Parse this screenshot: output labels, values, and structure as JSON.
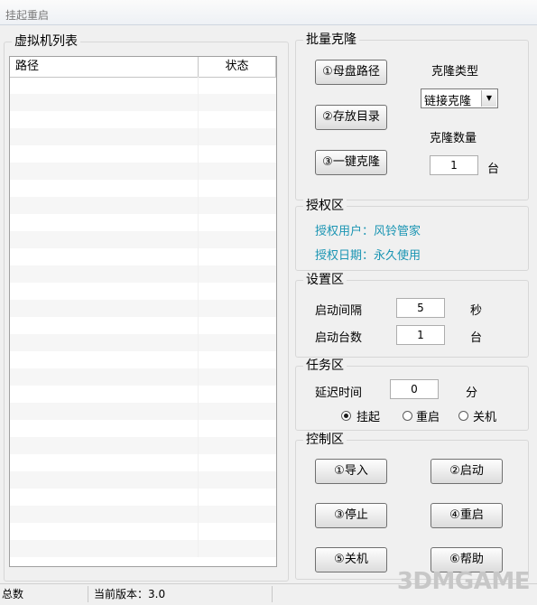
{
  "window": {
    "title": "挂起重启"
  },
  "vm_list": {
    "group_label": "虚拟机列表",
    "columns": [
      "路径",
      "状态"
    ]
  },
  "batch_clone": {
    "group_label": "批量克隆",
    "btn_parent_disk": "①母盘路径",
    "btn_store_dir": "②存放目录",
    "btn_one_click": "③一键克隆",
    "clone_type_label": "克隆类型",
    "clone_type_value": "链接克隆",
    "clone_count_label": "克隆数量",
    "clone_count_value": "1",
    "clone_count_unit": "台"
  },
  "license": {
    "group_label": "授权区",
    "user_label": "授权用户：风铃管家",
    "date_label": "授权日期：永久使用"
  },
  "settings": {
    "group_label": "设置区",
    "interval_label": "启动间隔",
    "interval_value": "5",
    "interval_unit": "秒",
    "count_label": "启动台数",
    "count_value": "1",
    "count_unit": "台"
  },
  "task": {
    "group_label": "任务区",
    "delay_label": "延迟时间",
    "delay_value": "0",
    "delay_unit": "分",
    "options": [
      "挂起",
      "重启",
      "关机"
    ],
    "selected": "挂起"
  },
  "control": {
    "group_label": "控制区",
    "btn_import": "①导入",
    "btn_start": "②启动",
    "btn_stop": "③停止",
    "btn_restart": "④重启",
    "btn_shutdown": "⑤关机",
    "btn_help": "⑥帮助"
  },
  "statusbar": {
    "total_label": "总数",
    "version_label": "当前版本：3.0"
  },
  "watermark": {
    "text": "3DMGAME"
  }
}
